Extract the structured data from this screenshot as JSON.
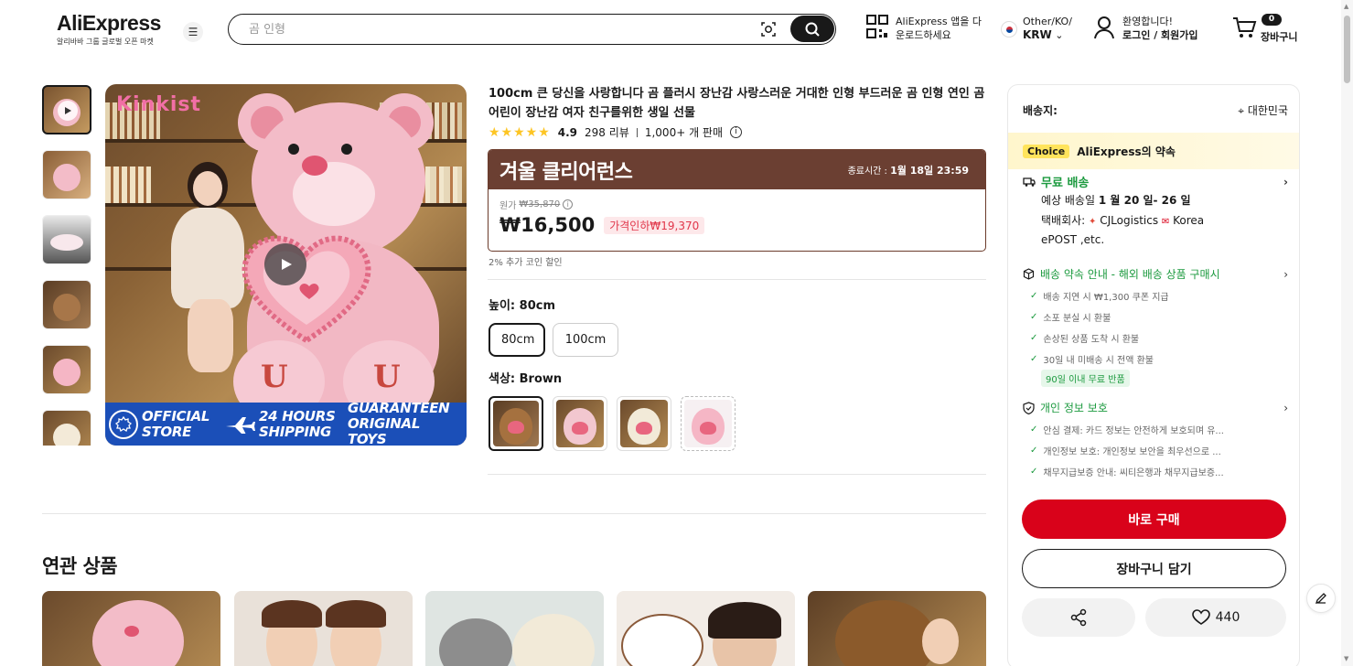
{
  "header": {
    "logo": "AliExpress",
    "logo_sub": "알리바바 그룹 글로벌 오픈 마켓",
    "search_placeholder": "곰 인형",
    "app_line1": "AliExpress 앱을 다",
    "app_line2": "운로드하세요",
    "lang_line1": "Other/KO/",
    "lang_line2": "KRW",
    "user_line1": "환영합니다!",
    "user_line2": "로그인 / 회원가입",
    "cart_count": "0",
    "cart_label": "장바구니"
  },
  "product": {
    "title": "100cm 큰 당신을 사랑합니다 곰 플러시 장난감 사랑스러운 거대한 인형 부드러운 곰 인형 연인 곰 어린이 장난감 여자 친구를위한 생일 선물",
    "rating": "4.9",
    "reviews": "298 리뷰",
    "sold": "1,000+ 개 판매",
    "stars": "★★★★★",
    "image_brand": "Kinkist",
    "banner_official": "OFFICIAL STORE",
    "banner_shipping": "24 HOURS SHIPPING",
    "banner_guarantee": "GUARANTEEN ORIGINAL TOYS"
  },
  "price": {
    "promo_title": "겨울 클리어런스",
    "end_label": "종료시간 :",
    "end_time": "1월 18일 23:59",
    "orig_label": "원가",
    "orig_price": "₩35,870",
    "current": "₩16,500",
    "discount": "가격인하₩19,370",
    "coin": "2% 추가 코인 할인"
  },
  "options": {
    "size_label": "높이: 80cm",
    "sizes": [
      "80cm",
      "100cm"
    ],
    "color_label": "색상: Brown"
  },
  "related": {
    "title": "연관 상품"
  },
  "panel": {
    "ship_to_label": "배송지:",
    "ship_to_value": "대한민국",
    "choice_tag": "Choice",
    "choice_text": "AliExpress의 약속",
    "free_ship": "무료 배송",
    "eta_prefix": "예상 배송일",
    "eta": "1 월 20 일- 26 일",
    "carrier_label": "택배회사:",
    "carrier_1": "CJLogistics",
    "carrier_2": "Korea",
    "carrier_3": "ePOST ,etc.",
    "promise_title": "배송 약속 안내 - 해외 배송 상품 구매시",
    "promise_items": [
      "배송 지연 시 ₩1,300 쿠폰 지급",
      "소포 분실 시 환불",
      "손상된 상품 도착 시 환불",
      "30일 내 미배송 시 전액 환불"
    ],
    "free_return": "90일 이내 무료 반품",
    "privacy_title": "개인 정보 보호",
    "privacy_items": [
      "안심 결제: 카드 정보는 안전하게 보호되며 유...",
      "개인정보 보호: 개인정보 보안을 최우선으로 ...",
      "채무지급보증 안내: 씨티은행과 채무지급보증..."
    ],
    "buy_now": "바로 구매",
    "add_cart": "장바구니 담기",
    "wish_count": "440"
  },
  "colors": {
    "brand_red": "#d9021a",
    "promo_brown": "#6b3f32",
    "green": "#1c9a3f",
    "choice_yellow": "#ffe45c"
  }
}
